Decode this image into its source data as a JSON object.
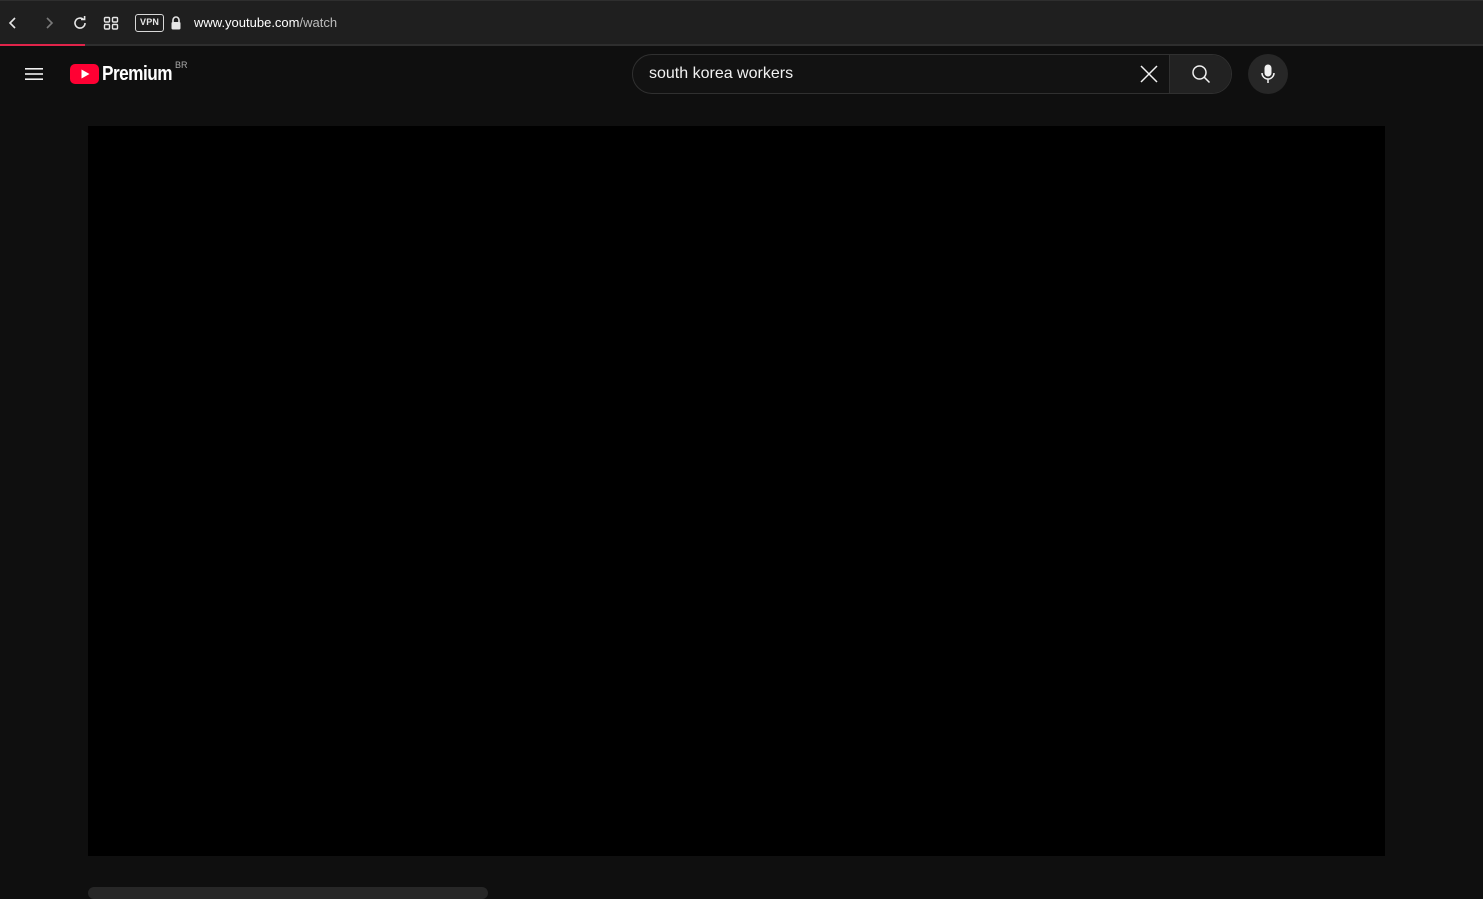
{
  "browser": {
    "vpn_label": "VPN",
    "url_host": "www.youtube.com",
    "url_path": "/watch",
    "page_load_progress": 0.057,
    "icons": {
      "back": "chevron-left-icon",
      "forward": "chevron-right-icon",
      "reload": "reload-icon",
      "tabs": "grid-icon",
      "lock": "lock-icon"
    },
    "accent_color": "#e0244a"
  },
  "masthead": {
    "logo_text": "Premium",
    "country_code": "BR",
    "search": {
      "value": "south korea workers"
    },
    "icons": {
      "menu": "hamburger-menu-icon",
      "logo": "youtube-play-icon",
      "clear": "close-icon",
      "search": "search-icon",
      "voice": "microphone-icon"
    },
    "brand_color": "#ff0033"
  },
  "player": {
    "background": "#000000"
  }
}
